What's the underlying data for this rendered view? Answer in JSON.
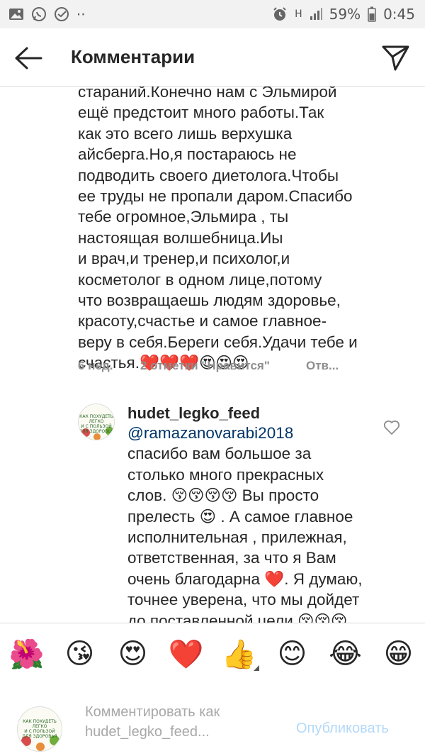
{
  "status_bar": {
    "battery_percent": "59%",
    "time": "0:45",
    "dots": "⋅⋅",
    "network": "H"
  },
  "header": {
    "title": "Комментарии"
  },
  "comment": {
    "text": "стараний.Конечно нам с Эльмирой\nещё предстоит много работы.Так\nкак это всего лишь верхушка\nайсберга.Но,я постараюсь не\nподводить своего диетолога.Чтобы\nее труды не пропали даром.Спасибо\nтебе огромное,Эльмира , ты\nнастоящая волшебница.Иы\nи врач,и тренер,и психолог,и\nкосметолог в одном лице,потому\nчто возвращаешь людям здоровье,\nкрасоту,счастье и самое главное-\nверу в себя.Береги себя.Удачи тебе и\nсчастья.❤️❤️❤️😍😍😍",
    "time": "6 нед.",
    "likes": "2 отметки \"Нравится\"",
    "reply": "Отв..."
  },
  "reply_comment": {
    "username": "hudet_legko_feed",
    "mention": "@ramazanovarabi2018",
    "text": "спасибо вам большое за\nстолько много прекрасных\nслов. 😚😚😚😚 Вы просто\nпрелесть 😍 . А самое главное\nисполнительная , прилежная,\nответственная, за что я Вам\nочень благодарна ❤️. Я думаю,\nточнее уверена, что мы дойдет\nдо поставленной цели 😚😚😚",
    "avatar_text": [
      "КАК ПОХУДЕТЬ",
      "ЛЕГКО",
      "И С ПОЛЬЗОЙ",
      "ДЛЯ ЗДОРОВЬЯ"
    ]
  },
  "emoji_bar": [
    "🌺",
    "😘",
    "😍",
    "❤️",
    "👍",
    "😊",
    "😂",
    "😁"
  ],
  "input": {
    "placeholder": "Комментировать как hudet_legko_feed...",
    "publish_label": "Опубликовать"
  },
  "colors": {
    "mention": "#003569",
    "publish_disabled": "#b3d9f9",
    "meta": "#8e8e8e",
    "status_bar_bg": "#f2f2f2"
  }
}
